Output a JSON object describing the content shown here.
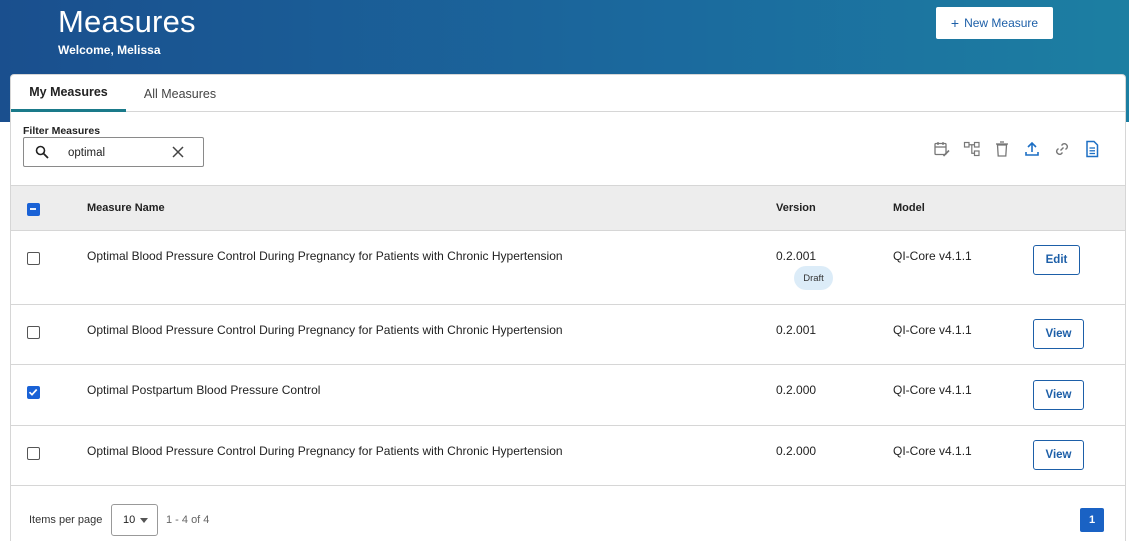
{
  "header": {
    "title": "Measures",
    "welcome": "Welcome, Melissa",
    "new_measure_label": "New Measure",
    "new_measure_icon": "plus-icon"
  },
  "tabs": [
    {
      "label": "My Measures",
      "active": true
    },
    {
      "label": "All Measures",
      "active": false
    }
  ],
  "filter": {
    "label": "Filter Measures",
    "value": "optimal",
    "search_icon": "search-icon",
    "clear_icon": "close-icon"
  },
  "toolbar": {
    "icons": [
      "calendar-edit-icon",
      "hierarchy-icon",
      "trash-icon",
      "upload-icon",
      "link-icon",
      "document-icon"
    ]
  },
  "table": {
    "headers": {
      "name": "Measure Name",
      "version": "Version",
      "model": "Model"
    },
    "select_all_state": "indeterminate",
    "rows": [
      {
        "name": "Optimal Blood Pressure Control During Pregnancy for Patients with Chronic Hypertension",
        "version": "0.2.001",
        "badge": "Draft",
        "model": "QI-Core v4.1.1",
        "action": "Edit",
        "checked": false
      },
      {
        "name": "Optimal Blood Pressure Control During Pregnancy for Patients with Chronic Hypertension",
        "version": "0.2.001",
        "badge": "",
        "model": "QI-Core v4.1.1",
        "action": "View",
        "checked": false
      },
      {
        "name": "Optimal Postpartum Blood Pressure Control",
        "version": "0.2.000",
        "badge": "",
        "model": "QI-Core v4.1.1",
        "action": "View",
        "checked": true
      },
      {
        "name": "Optimal Blood Pressure Control During Pregnancy for Patients with Chronic Hypertension",
        "version": "0.2.000",
        "badge": "",
        "model": "QI-Core v4.1.1",
        "action": "View",
        "checked": false
      }
    ]
  },
  "pagination": {
    "items_per_page_label": "Items per page",
    "items_per_page": "10",
    "range": "1 - 4 of 4",
    "current_page": "1"
  },
  "colors": {
    "banner_start": "#1a4f8e",
    "banner_end": "#1c7fa2",
    "accent": "#1a62d6",
    "tab_indicator": "#1a7a8a",
    "link": "#1d5fa8"
  }
}
